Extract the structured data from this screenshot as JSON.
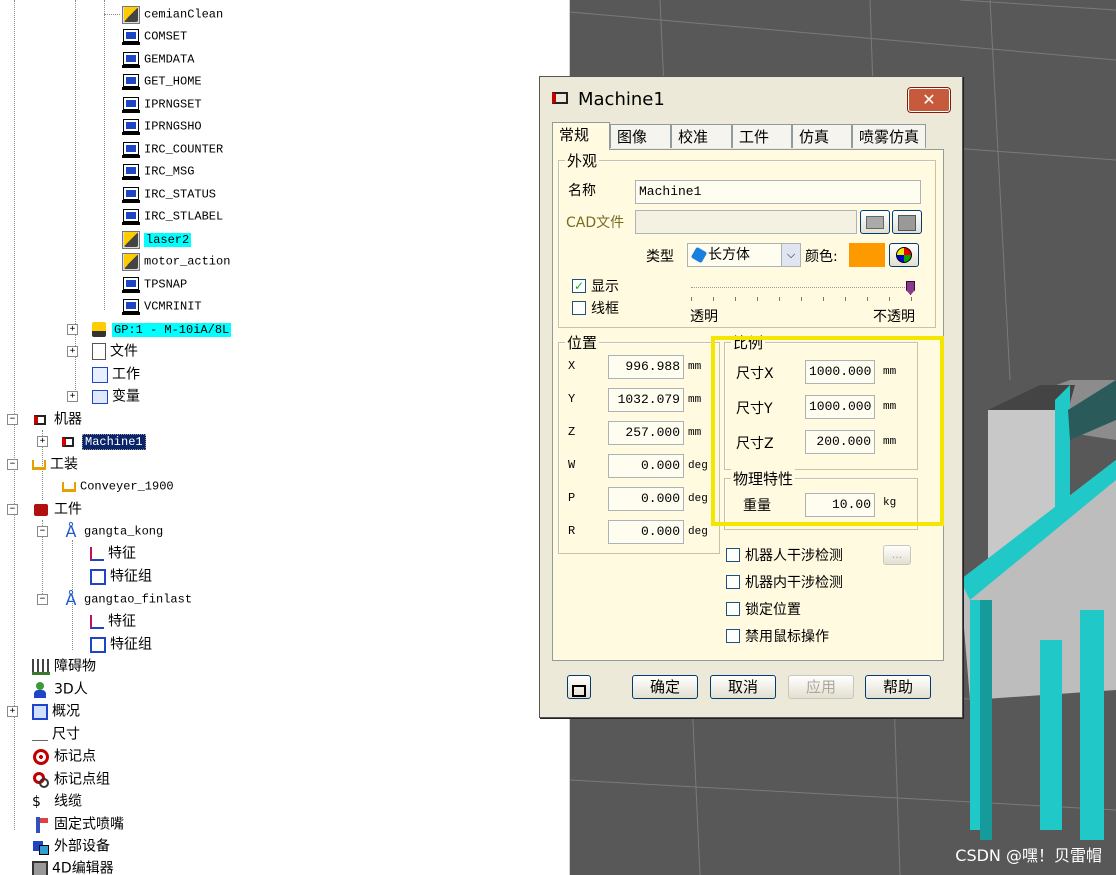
{
  "tree": {
    "items": [
      {
        "label": "cemianClean",
        "icon": "robot-program-icon",
        "style": "mono"
      },
      {
        "label": "COMSET",
        "icon": "program-icon",
        "style": "mono"
      },
      {
        "label": "GEMDATA",
        "icon": "program-icon",
        "style": "mono"
      },
      {
        "label": "GET_HOME",
        "icon": "program-icon",
        "style": "mono"
      },
      {
        "label": "IPRNGSET",
        "icon": "program-icon",
        "style": "mono"
      },
      {
        "label": "IPRNGSHO",
        "icon": "program-icon",
        "style": "mono"
      },
      {
        "label": "IRC_COUNTER",
        "icon": "program-icon",
        "style": "mono"
      },
      {
        "label": "IRC_MSG",
        "icon": "program-icon",
        "style": "mono"
      },
      {
        "label": "IRC_STATUS",
        "icon": "program-icon",
        "style": "mono"
      },
      {
        "label": "IRC_STLABEL",
        "icon": "program-icon",
        "style": "mono"
      },
      {
        "label": "laser2",
        "icon": "robot-program-icon",
        "style": "mono"
      },
      {
        "label": "motor_action",
        "icon": "robot-program-icon",
        "style": "mono"
      },
      {
        "label": "TPSNAP",
        "icon": "program-icon",
        "style": "mono"
      },
      {
        "label": "VCMRINIT",
        "icon": "program-icon",
        "style": "mono"
      },
      {
        "label": "GP:1 - M-10iA/8L",
        "icon": "robot-arm-icon",
        "style": "mono"
      },
      {
        "label": "文件",
        "icon": "file-icon",
        "style": "cjk"
      },
      {
        "label": "工作",
        "icon": "job-icon",
        "style": "cjk"
      },
      {
        "label": "变量",
        "icon": "variable-icon",
        "style": "cjk"
      },
      {
        "label": "机器",
        "icon": "machine-icon",
        "style": "cjk"
      },
      {
        "label": "Machine1",
        "icon": "machine-icon",
        "style": "mono"
      },
      {
        "label": "工装",
        "icon": "fixture-icon",
        "style": "cjk"
      },
      {
        "label": "Conveyer_1900",
        "icon": "fixture-icon",
        "style": "mono"
      },
      {
        "label": "工件",
        "icon": "part-icon",
        "style": "cjk"
      },
      {
        "label": "gangta_kong",
        "icon": "part-item-icon",
        "style": "mono"
      },
      {
        "label": "特征",
        "icon": "feature-icon",
        "style": "cjk"
      },
      {
        "label": "特征组",
        "icon": "feature-group-icon",
        "style": "cjk"
      },
      {
        "label": "gangtao_finlast",
        "icon": "part-item-icon",
        "style": "mono"
      },
      {
        "label": "特征",
        "icon": "feature-icon",
        "style": "cjk"
      },
      {
        "label": "特征组",
        "icon": "feature-group-icon",
        "style": "cjk"
      },
      {
        "label": "障碍物",
        "icon": "obstacle-icon",
        "style": "cjk"
      },
      {
        "label": "3D人",
        "icon": "person-icon",
        "style": "cjk"
      },
      {
        "label": "概况",
        "icon": "overview-icon",
        "style": "cjk"
      },
      {
        "label": "尺寸",
        "icon": "dimension-icon",
        "style": "cjk"
      },
      {
        "label": "标记点",
        "icon": "target-icon",
        "style": "cjk"
      },
      {
        "label": "标记点组",
        "icon": "target-group-icon",
        "style": "cjk"
      },
      {
        "label": "线缆",
        "icon": "cable-icon",
        "style": "cjk"
      },
      {
        "label": "固定式喷嘴",
        "icon": "nozzle-icon",
        "style": "cjk"
      },
      {
        "label": "外部设备",
        "icon": "device-icon",
        "style": "cjk"
      },
      {
        "label": "4D编辑器",
        "icon": "editor-icon",
        "style": "cjk"
      }
    ]
  },
  "dialog": {
    "title": "Machine1",
    "close_symbol": "✕",
    "tabs": [
      "常规",
      "图像",
      "校准",
      "工件",
      "仿真",
      "喷雾仿真"
    ],
    "appearance": {
      "group_title": "外观",
      "name_label": "名称",
      "name_value": "Machine1",
      "cad_label": "CAD文件",
      "cad_value": "",
      "type_label": "类型",
      "type_value": "长方体",
      "color_label": "颜色:",
      "color_value": "#ff9900",
      "show_label": "显示",
      "show_checked": true,
      "wire_label": "线框",
      "wire_checked": false,
      "transparent_label": "透明",
      "opaque_label": "不透明",
      "opacity": 1.0
    },
    "position": {
      "group_title": "位置",
      "rows": [
        {
          "label": "X",
          "value": "996.988",
          "unit": "mm"
        },
        {
          "label": "Y",
          "value": "1032.079",
          "unit": "mm"
        },
        {
          "label": "Z",
          "value": "257.000",
          "unit": "mm"
        },
        {
          "label": "W",
          "value": "0.000",
          "unit": "deg"
        },
        {
          "label": "P",
          "value": "0.000",
          "unit": "deg"
        },
        {
          "label": "R",
          "value": "0.000",
          "unit": "deg"
        }
      ]
    },
    "scale": {
      "group_title": "比例",
      "rows": [
        {
          "label": "尺寸X",
          "value": "1000.000",
          "unit": "mm"
        },
        {
          "label": "尺寸Y",
          "value": "1000.000",
          "unit": "mm"
        },
        {
          "label": "尺寸Z",
          "value": "200.000",
          "unit": "mm"
        }
      ]
    },
    "physics": {
      "group_title": "物理特性",
      "weight_label": "重量",
      "weight_value": "10.00",
      "weight_unit": "kg"
    },
    "options": [
      {
        "label": "机器人干涉检测",
        "checked": false
      },
      {
        "label": "机器内干涉检测",
        "checked": false
      },
      {
        "label": "锁定位置",
        "checked": false
      },
      {
        "label": "禁用鼠标操作",
        "checked": false
      }
    ],
    "ellipsis_label": "...",
    "buttons": {
      "ok": "确定",
      "cancel": "取消",
      "apply": "应用",
      "help": "帮助"
    }
  },
  "watermark": "CSDN @嘿！贝雷帽",
  "colors": {
    "highlight": "#00ffff",
    "selection": "#0a246a",
    "annotation_box": "#f5e600",
    "view_bg": "#585858",
    "conveyor_accent": "#21c8c8"
  }
}
